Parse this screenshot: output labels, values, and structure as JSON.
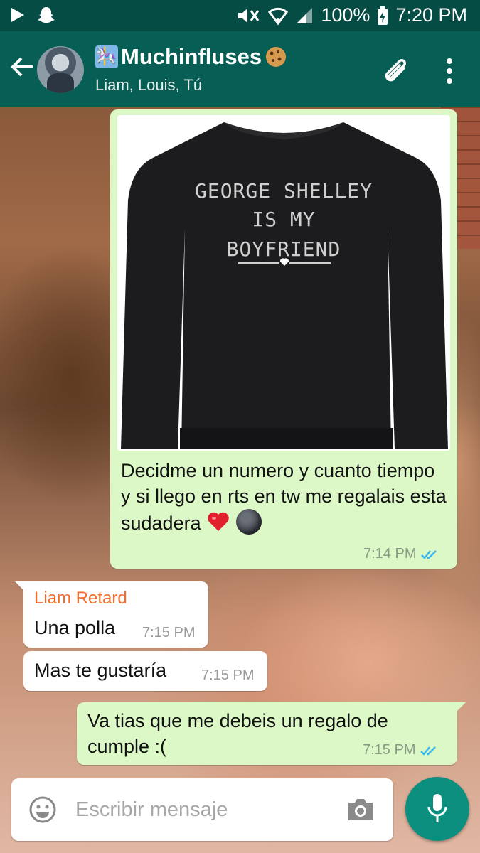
{
  "status_bar": {
    "battery": "100%",
    "time": "7:20 PM"
  },
  "header": {
    "title": "Muchinfluses",
    "participants": "Liam, Louis, Tú"
  },
  "messages": {
    "image_message": {
      "shirt_lines": [
        "GEORGE SHELLEY",
        "IS MY",
        "BOYFRIEND"
      ],
      "caption": "Decidme un numero y cuanto tiempo y si llego en rts en tw me regalais esta sudadera",
      "time": "7:14 PM"
    },
    "incoming_1": {
      "sender": "Liam Retard",
      "text": "Una polla",
      "time": "7:15 PM"
    },
    "incoming_2": {
      "text": "Mas te gustaría",
      "time": "7:15 PM"
    },
    "outgoing_1": {
      "text": "Va tias que me debeis un regalo de cumple :(",
      "time": "7:15 PM"
    }
  },
  "input": {
    "placeholder": "Escribir mensaje"
  },
  "colors": {
    "header": "#075e54",
    "statusbar": "#054d44",
    "outgoing_bubble": "#dcf8c6",
    "sender_name": "#f26c2c",
    "read_ticks": "#34b7f1",
    "fab": "#0d8f7f"
  }
}
